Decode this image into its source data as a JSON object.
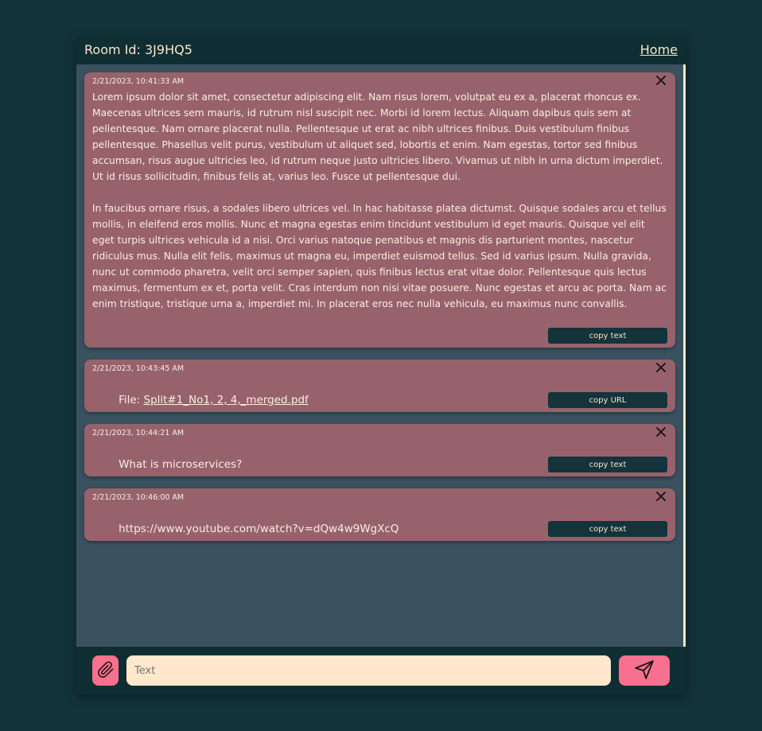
{
  "header": {
    "room_label": "Room Id: 3J9HQ5",
    "home_link": "Home"
  },
  "messages": [
    {
      "timestamp": "2/21/2023, 10:41:33 AM",
      "text": "Lorem ipsum dolor sit amet, consectetur adipiscing elit. Nam risus lorem, volutpat eu ex a, placerat rhoncus ex. Maecenas ultrices sem mauris, id rutrum nisl suscipit nec. Morbi id lorem lectus. Aliquam dapibus quis sem at pellentesque. Nam ornare placerat nulla. Pellentesque ut erat ac nibh ultrices finibus. Duis vestibulum finibus pellentesque. Phasellus velit purus, vestibulum ut aliquet sed, lobortis et enim. Nam egestas, tortor sed finibus accumsan, risus augue ultricies leo, id rutrum neque justo ultricies libero. Vivamus ut nibh in urna dictum imperdiet. Ut id risus sollicitudin, finibus felis at, varius leo. Fusce ut pellentesque dui.\n\nIn faucibus ornare risus, a sodales libero ultrices vel. In hac habitasse platea dictumst. Quisque sodales arcu et tellus mollis, in eleifend eros mollis. Nunc et magna egestas enim tincidunt vestibulum id eget mauris. Quisque vel elit eget turpis ultrices vehicula id a nisi. Orci varius natoque penatibus et magnis dis parturient montes, nascetur ridiculus mus. Nulla elit felis, maximus ut magna eu, imperdiet euismod tellus. Sed id varius ipsum. Nulla gravida, nunc ut commodo pharetra, velit orci semper sapien, quis finibus lectus erat vitae dolor. Pellentesque quis lectus maximus, fermentum ex et, porta velit. Cras interdum non nisi vitae posuere. Nunc egestas et arcu ac porta. Nam ac enim tristique, tristique urna a, imperdiet mi. In placerat eros nec nulla vehicula, eu maximus nunc convallis.",
      "copy_label": "copy text"
    },
    {
      "timestamp": "2/21/2023, 10:43:45 AM",
      "file_prefix": "File: ",
      "file_name": "Split#1_No1, 2, 4,_merged.pdf",
      "copy_label": "copy URL"
    },
    {
      "timestamp": "2/21/2023, 10:44:21 AM",
      "text": "What is microservices?",
      "copy_label": "copy text"
    },
    {
      "timestamp": "2/21/2023, 10:46:00 AM",
      "text": "https://www.youtube.com/watch?v=dQw4w9WgXcQ",
      "copy_label": "copy text"
    }
  ],
  "composer": {
    "placeholder": "Text",
    "attach_icon": "paperclip-icon",
    "send_icon": "paper-plane-icon"
  },
  "colors": {
    "page_bg": "#12333a",
    "panel_bg": "#0f2e34",
    "messages_bg": "#3a5260",
    "card_bg": "#97626c",
    "text_cream": "#f7e6cb",
    "accent_pink": "#f7708e",
    "input_bg": "#ffe8cc",
    "button_dark": "#14333a"
  }
}
